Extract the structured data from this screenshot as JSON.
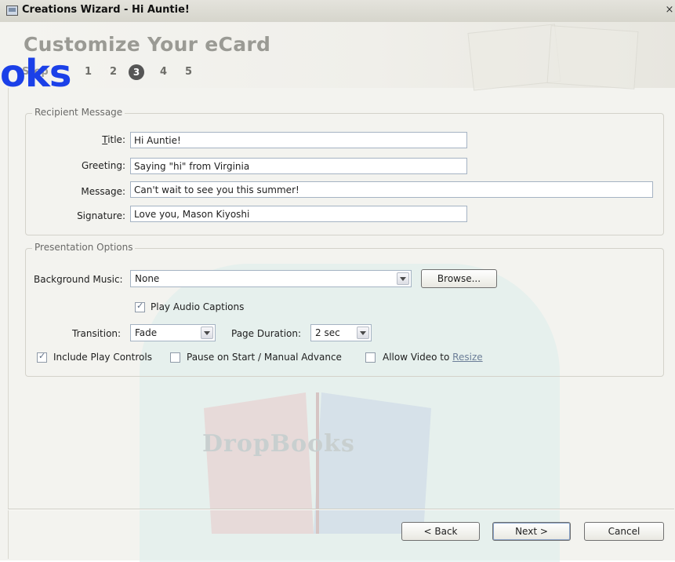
{
  "window": {
    "title": "Creations Wizard - Hi Auntie!",
    "close_glyph": "×"
  },
  "header": {
    "title": "Customize Your eCard",
    "steps_label": "Step",
    "steps": [
      "1",
      "2",
      "3",
      "4",
      "5"
    ],
    "current_step": "3"
  },
  "overlay_logo": "oks",
  "watermark": "DropBooks",
  "recipient": {
    "legend": "Recipient Message",
    "title_label": "Title:",
    "title_value": "Hi Auntie!",
    "greeting_label": "Greeting:",
    "greeting_value": "Saying \"hi\" from Virginia",
    "message_label": "Message:",
    "message_value": "Can't wait to see you this summer!",
    "signature_label": "Signature:",
    "signature_value": "Love you, Mason Kiyoshi"
  },
  "presentation": {
    "legend": "Presentation Options",
    "music_label": "Background Music:",
    "music_value": "None",
    "browse_label": "Browse...",
    "audio_captions_label": "Play Audio Captions",
    "audio_captions_checked": true,
    "transition_label": "Transition:",
    "transition_value": "Fade",
    "duration_label": "Page Duration:",
    "duration_value": "2 sec",
    "play_controls_label": "Include Play Controls",
    "play_controls_checked": true,
    "pause_label": "Pause on Start / Manual Advance",
    "pause_checked": false,
    "allow_video_label": "Allow Video to",
    "resize_link": "Resize",
    "allow_video_checked": false
  },
  "footer": {
    "back_label": "< Back",
    "next_label": "Next >",
    "cancel_label": "Cancel"
  },
  "colors": {
    "link": "#6c7e98",
    "logo_overlay": "#1b40e8",
    "watermark_bg": "#dbeceb"
  }
}
